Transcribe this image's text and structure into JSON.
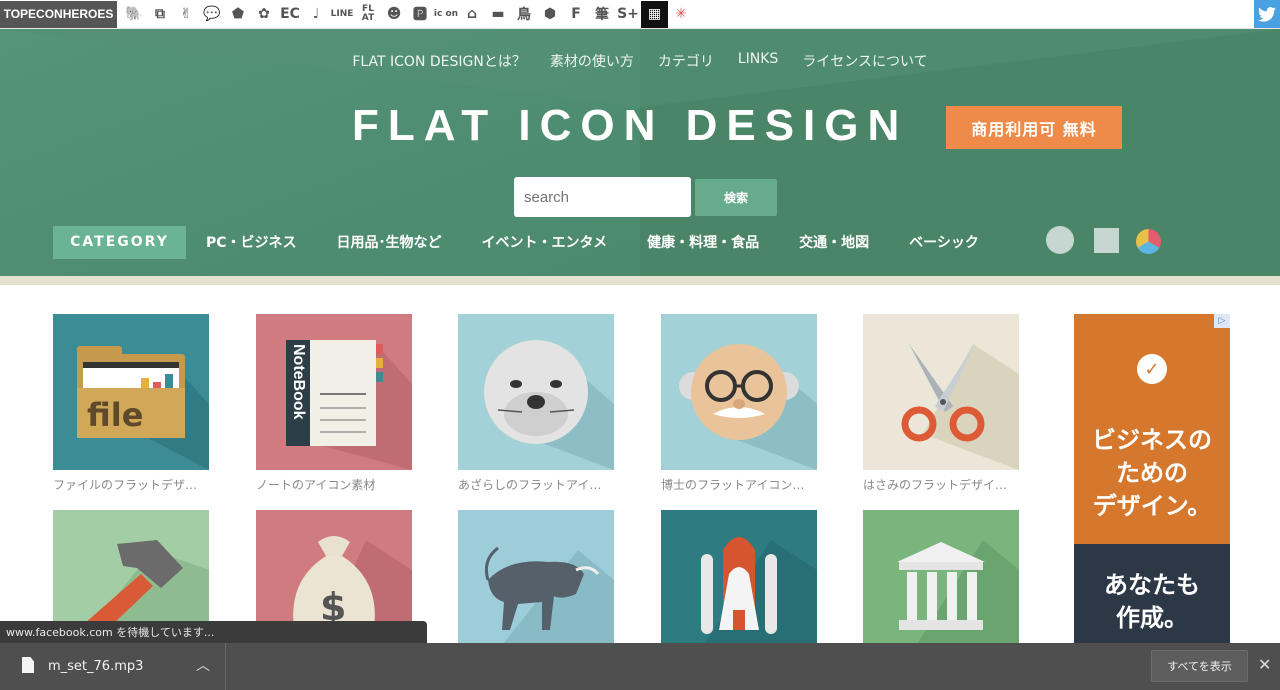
{
  "topbar": {
    "brand": "TOPECONHEROES",
    "sites": [
      {
        "icon": "elephant-icon",
        "glyph": "🐘",
        "type": "emoji"
      },
      {
        "icon": "windows-icon",
        "glyph": "⧉",
        "type": "glyph"
      },
      {
        "icon": "person-icon",
        "glyph": "✌",
        "type": "glyph"
      },
      {
        "icon": "speech-bubble-icon",
        "glyph": "💬",
        "type": "emoji"
      },
      {
        "icon": "tag-icon",
        "glyph": "⬟",
        "type": "glyph"
      },
      {
        "icon": "gear-icon",
        "glyph": "✿",
        "type": "glyph"
      },
      {
        "icon": "ec-icon",
        "glyph": "EC",
        "type": "text"
      },
      {
        "icon": "music-note-icon",
        "glyph": "♩",
        "type": "glyph"
      },
      {
        "icon": "line-icon",
        "glyph": "LINE",
        "type": "small"
      },
      {
        "icon": "flat-icon",
        "glyph": "FL AT",
        "type": "small"
      },
      {
        "icon": "smiley-icon",
        "glyph": "☻",
        "type": "glyph"
      },
      {
        "icon": "parking-icon",
        "glyph": "🅿",
        "type": "glyph"
      },
      {
        "icon": "icon-text-icon",
        "glyph": "ic on",
        "type": "small"
      },
      {
        "icon": "building-icon",
        "glyph": "⌂",
        "type": "glyph"
      },
      {
        "icon": "bed-icon",
        "glyph": "▬",
        "type": "glyph"
      },
      {
        "icon": "bird-kanji-icon",
        "glyph": "鳥",
        "type": "text"
      },
      {
        "icon": "hexagon-icon",
        "glyph": "⬢",
        "type": "glyph"
      },
      {
        "icon": "f-letter-icon",
        "glyph": "F",
        "type": "text"
      },
      {
        "icon": "brush-kanji-icon",
        "glyph": "筆",
        "type": "text"
      },
      {
        "icon": "s-plus-icon",
        "glyph": "S+",
        "type": "text"
      },
      {
        "icon": "grid-icon",
        "glyph": "▦",
        "type": "grid"
      },
      {
        "icon": "burst-icon",
        "glyph": "✳",
        "type": "burst"
      }
    ],
    "twitter_icon": "twitter-icon"
  },
  "hero": {
    "nav": [
      "FLAT ICON DESIGNとは？",
      "素材の使い方",
      "カテゴリ",
      "LINKS",
      "ライセンスについて"
    ],
    "logo": "FLAT ICON DESIGN",
    "badge": "商用利用可 無料",
    "search_placeholder": "search",
    "search_button": "検索",
    "category_label": "CATEGORY",
    "categories": [
      "PC・ビジネス",
      "日用品･生物など",
      "イベント・エンタメ",
      "健康・料理・食品",
      "交通・地図",
      "ベーシック"
    ],
    "colors": {
      "green": "#4e8c71",
      "badge": "#ee8b49",
      "button": "#66ac8c"
    }
  },
  "icons": [
    {
      "name": "folder-file-icon",
      "caption": "ファイルのフラットデザ…",
      "bg": "#3c8c96"
    },
    {
      "name": "notebook-icon",
      "caption": "ノートのアイコン素材",
      "bg": "#d07b80"
    },
    {
      "name": "seal-icon",
      "caption": "あざらしのフラットアイ…",
      "bg": "#a2d1d7"
    },
    {
      "name": "professor-icon",
      "caption": "博士のフラットアイコン…",
      "bg": "#a2d1d7"
    },
    {
      "name": "scissors-icon",
      "caption": "はさみのフラットデザイ…",
      "bg": "#ebe6d8"
    },
    {
      "name": "hammer-icon",
      "caption": "",
      "bg": "#a3cea5"
    },
    {
      "name": "money-bag-icon",
      "caption": "",
      "bg": "#d07b80"
    },
    {
      "name": "bull-icon",
      "caption": "",
      "bg": "#9ccdd9"
    },
    {
      "name": "space-shuttle-icon",
      "caption": "",
      "bg": "#2e7c82"
    },
    {
      "name": "bank-building-icon",
      "caption": "",
      "bg": "#79b57c"
    }
  ],
  "ad": {
    "text1": "ビジネスの\nための\nデザイン。",
    "text2": "あなたも\n作成。",
    "corner": "▷"
  },
  "status_bar": "www.facebook.com を待機しています...",
  "downloads": {
    "file_name": "m_set_76.mp3",
    "show_all": "すべてを表示",
    "close": "✕",
    "chevron": "︿"
  }
}
